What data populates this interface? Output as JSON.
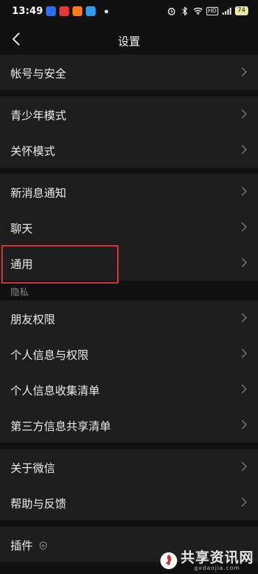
{
  "status": {
    "time": "13:49",
    "battery": "74",
    "network_label": "HD"
  },
  "header": {
    "title": "设置"
  },
  "groups": {
    "account": [
      "帐号与安全"
    ],
    "modes": [
      "青少年模式",
      "关怀模式"
    ],
    "general": [
      "新消息通知",
      "聊天",
      "通用"
    ],
    "privacy_header": "隐私",
    "privacy": [
      "朋友权限",
      "个人信息与权限",
      "个人信息收集清单",
      "第三方信息共享清单"
    ],
    "about": [
      "关于微信",
      "帮助与反馈"
    ],
    "plugins": "插件"
  },
  "watermark": {
    "title": "共享资讯网",
    "url": "gxdaojia.com"
  },
  "colors": {
    "highlight": "#e0353b",
    "background": "#111111",
    "row": "#1e1e1e"
  }
}
